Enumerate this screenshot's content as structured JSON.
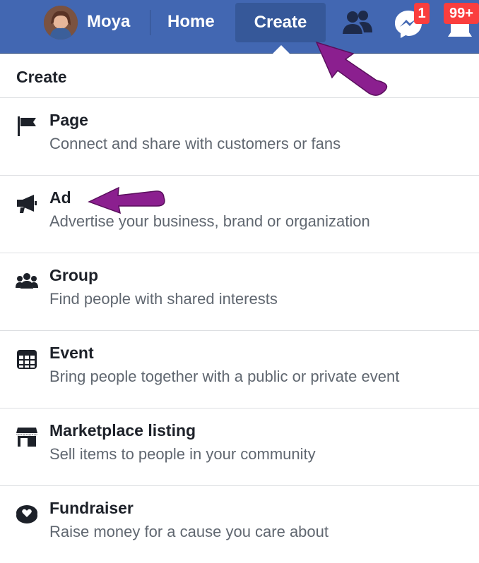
{
  "topbar": {
    "user_name": "Moya",
    "nav_home": "Home",
    "nav_create": "Create",
    "messenger_badge": "1",
    "notifications_badge": "99+",
    "icons": [
      "avatar",
      "friends-icon",
      "messenger-icon",
      "notifications-icon"
    ],
    "colors": {
      "bar": "#4267b2",
      "active_tab": "#365899",
      "badge": "#fa3e3e"
    }
  },
  "menu": {
    "header": "Create",
    "items": [
      {
        "icon": "flag-icon",
        "title": "Page",
        "description": "Connect and share with customers or fans"
      },
      {
        "icon": "megaphone-icon",
        "title": "Ad",
        "description": "Advertise your business, brand or organization"
      },
      {
        "icon": "group-icon",
        "title": "Group",
        "description": "Find people with shared interests"
      },
      {
        "icon": "calendar-icon",
        "title": "Event",
        "description": "Bring people together with a public or private event"
      },
      {
        "icon": "storefront-icon",
        "title": "Marketplace listing",
        "description": "Sell items to people in your community"
      },
      {
        "icon": "heart-coin-icon",
        "title": "Fundraiser",
        "description": "Raise money for a cause you care about"
      }
    ]
  },
  "annotations": {
    "arrow_color": "#8b1f8f"
  }
}
